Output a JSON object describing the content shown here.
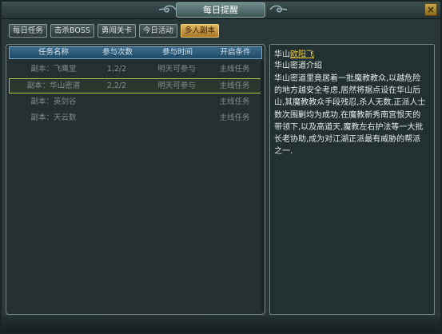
{
  "window": {
    "title": "每日提醒",
    "close_label": "×"
  },
  "tabs": [
    {
      "label": "每日任务",
      "active": false
    },
    {
      "label": "击杀BOSS",
      "active": false
    },
    {
      "label": "勇闯关卡",
      "active": false
    },
    {
      "label": "今日活动",
      "active": false
    },
    {
      "label": "多人副本",
      "active": true
    }
  ],
  "table": {
    "headers": [
      "任务名称",
      "参与次数",
      "参与时间",
      "开启条件"
    ],
    "rows": [
      {
        "name": "副本：飞鹰堂",
        "count": "1,2/2",
        "time": "明天可参与",
        "condition": "主线任务",
        "selected": false
      },
      {
        "name": "副本：华山密道",
        "count": "2,2/2",
        "time": "明天可参与",
        "condition": "主线任务",
        "selected": true
      },
      {
        "name": "副本：英剑谷",
        "count": "",
        "time": "",
        "condition": "主线任务",
        "selected": false
      },
      {
        "name": "副本：天云数",
        "count": "",
        "time": "",
        "condition": "主线任务",
        "selected": false
      }
    ]
  },
  "detail": {
    "location": "华山",
    "npc": "欧阳飞",
    "heading": "华山密道介绍",
    "body_lines": [
      "华山密道里竟居着一批魔教教众,以越危险",
      "的地方越安全考虑,居然将据点设在华山后",
      "山,其魔教教众手段残忍,杀人无数,正派人士",
      "数次围剿均为成功.在魔教新秀南宫恨天的",
      "带领下,以及高道天,魔教左右护法等一大批",
      "长老协助,成为对江湖正派最有威胁的帮派",
      "之一."
    ]
  },
  "colors": {
    "accent_gold": "#f0d040",
    "selection_border": "#b4c23e",
    "header_blue": "#2a5a7a"
  }
}
